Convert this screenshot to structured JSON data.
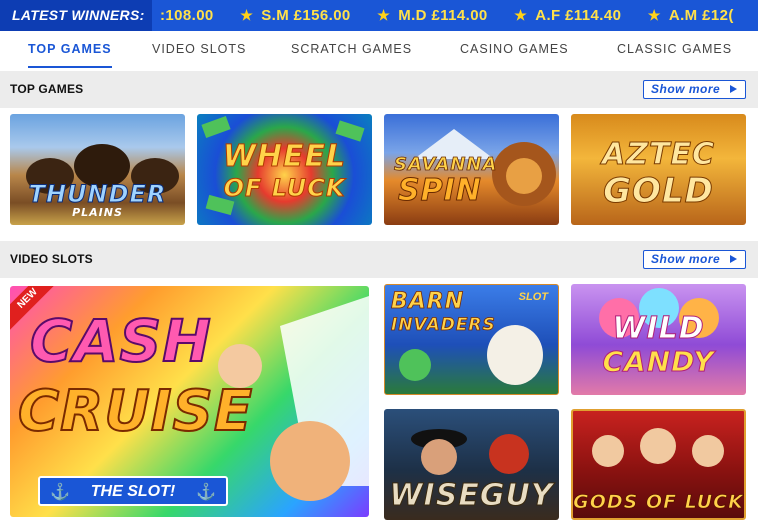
{
  "ticker": {
    "label": "LATEST WINNERS:",
    "items": [
      {
        "text": ":108.00",
        "star": false
      },
      {
        "text": "S.M £156.00",
        "star": true
      },
      {
        "text": "M.D £114.00",
        "star": true
      },
      {
        "text": "A.F £114.40",
        "star": true
      },
      {
        "text": "A.M £12(",
        "star": true
      }
    ]
  },
  "tabs": [
    {
      "label": "TOP GAMES",
      "active": true
    },
    {
      "label": "VIDEO SLOTS",
      "active": false
    },
    {
      "label": "SCRATCH GAMES",
      "active": false
    },
    {
      "label": "CASINO GAMES",
      "active": false
    },
    {
      "label": "CLASSIC GAMES",
      "active": false
    }
  ],
  "sections": [
    {
      "title": "TOP GAMES",
      "show_more": "Show more",
      "games": [
        {
          "title": "THUNDER",
          "subtitle": "PLAINS"
        },
        {
          "title": "WHEEL",
          "subtitle": "OF LUCK"
        },
        {
          "title": "SAVANNA",
          "subtitle": "SPIN"
        },
        {
          "title": "AZTEC",
          "subtitle": "GOLD"
        }
      ]
    },
    {
      "title": "VIDEO SLOTS",
      "show_more": "Show more",
      "featured": {
        "title": "CASH",
        "subtitle": "CRUISE",
        "tagline": "THE SLOT!",
        "badge": "NEW"
      },
      "games": [
        {
          "title": "BARN",
          "subtitle": "INVADERS",
          "tag": "SLOT"
        },
        {
          "title": "WILD",
          "subtitle": "CANDY"
        },
        {
          "title": "WISEGUY"
        },
        {
          "title": "GODS OF LUCK"
        }
      ]
    }
  ],
  "colors": {
    "brand_blue": "#1a56d6",
    "ticker_dark": "#0d3db3",
    "ticker_text": "#ffe14a",
    "section_bg": "#ececec",
    "new_badge": "#e0201e"
  }
}
